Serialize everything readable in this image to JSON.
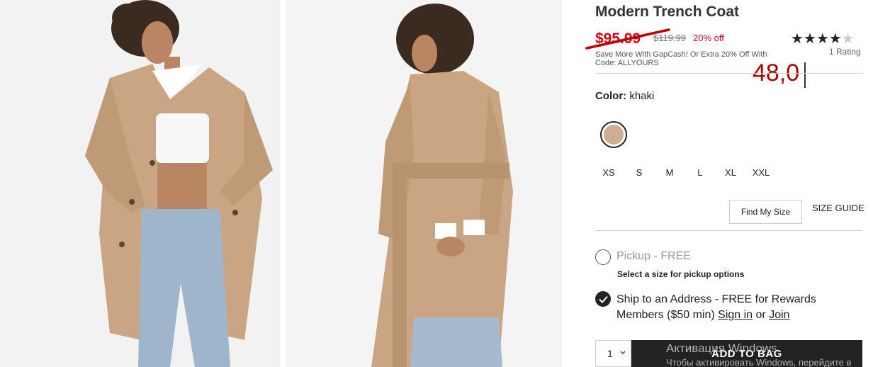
{
  "product": {
    "title": "Modern Trench Coat",
    "sale_price": "$95.99",
    "original_price": "$119.99",
    "discount": "20% off",
    "promo": "Save More With GapCash! Or Extra 20% Off With Code: ALLYOURS",
    "rating": {
      "stars": 4,
      "max": 5,
      "count_label": "1 Rating"
    }
  },
  "annotation": {
    "text": "48,0"
  },
  "color": {
    "label": "Color:",
    "value": "khaki",
    "swatch_hex": "#cfae8f"
  },
  "sizes": [
    "XS",
    "S",
    "M",
    "L",
    "XL",
    "XXL"
  ],
  "fit": {
    "find_my_size": "Find My Size",
    "size_guide": "SIZE GUIDE"
  },
  "fulfillment": {
    "pickup_label": "Pickup - FREE",
    "pickup_note": "Select a size for pickup options",
    "ship_prefix": "Ship to an Address - FREE for Rewards Members ($50 min) ",
    "sign_in": "Sign in",
    "or": " or ",
    "join": "Join"
  },
  "purchase": {
    "quantity": "1",
    "add_to_bag": "ADD TO BAG"
  },
  "watermark": {
    "title": "Активация Windows",
    "subtitle": "Чтобы активировать Windows, перейдите в"
  },
  "colors": {
    "sale_red": "#d0021b",
    "annotation_red": "#a80000",
    "button_dark": "#222222",
    "coat_khaki": "#c9a583",
    "denim_blue": "#9fb5cc"
  }
}
